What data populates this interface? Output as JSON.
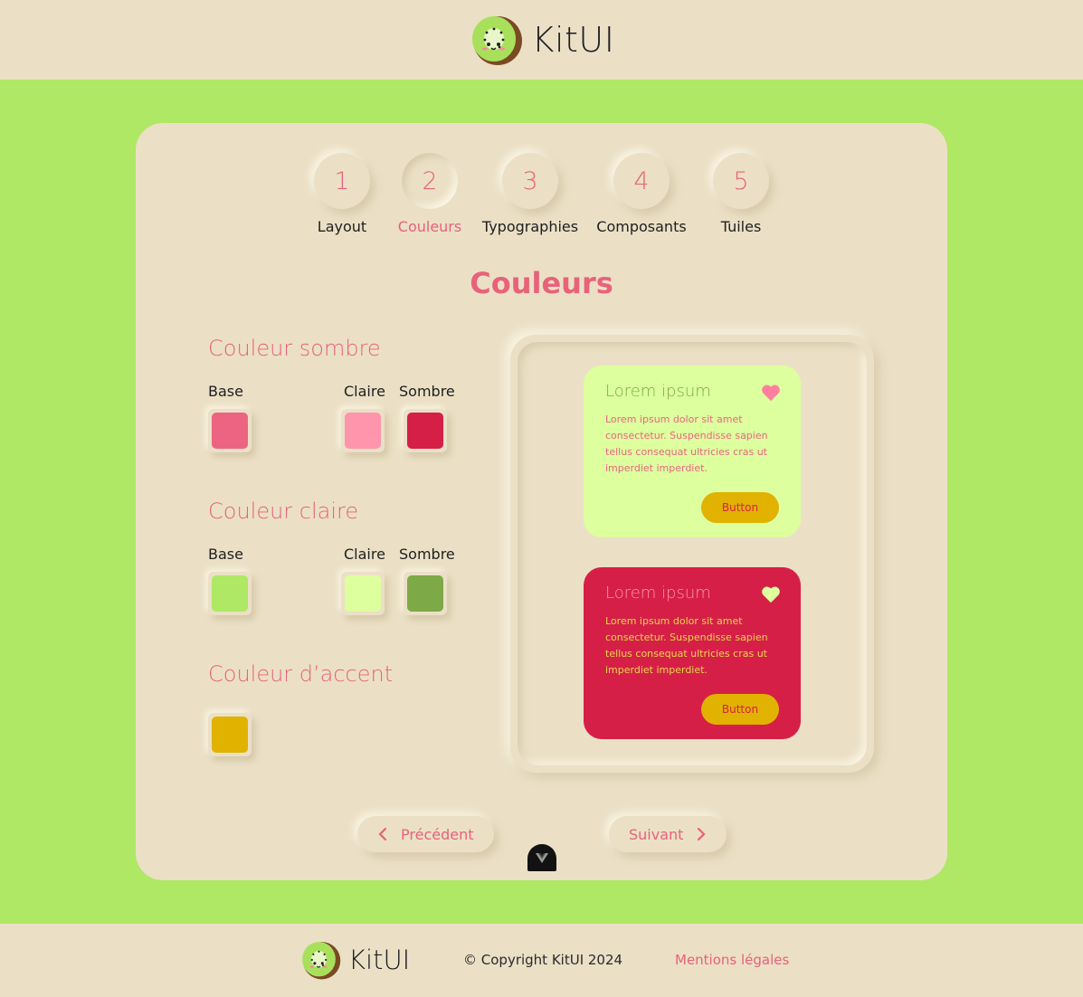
{
  "header": {
    "brand": "KitUI"
  },
  "stepper": [
    {
      "number": "1",
      "label": "Layout",
      "active": false
    },
    {
      "number": "2",
      "label": "Couleurs",
      "active": true
    },
    {
      "number": "3",
      "label": "Typographies",
      "active": false
    },
    {
      "number": "4",
      "label": "Composants",
      "active": false
    },
    {
      "number": "5",
      "label": "Tuiles",
      "active": false
    }
  ],
  "main": {
    "title": "Couleurs",
    "groups": {
      "dark": {
        "title": "Couleur sombre",
        "base_label": "Base",
        "light_label": "Claire",
        "dark_label": "Sombre",
        "base": "#ec6482",
        "light": "#ff95ac",
        "dark": "#d61f47"
      },
      "light": {
        "title": "Couleur claire",
        "base_label": "Base",
        "light_label": "Claire",
        "dark_label": "Sombre",
        "base": "#aee864",
        "light": "#ddff9e",
        "dark": "#7da947"
      },
      "accent": {
        "title": "Couleur d’accent",
        "base": "#e1b200"
      }
    },
    "preview": {
      "light_card": {
        "title": "Lorem ipsum",
        "text": "Lorem ipsum dolor sit amet consectetur. Suspendisse sapien tellus consequat ultricies cras ut imperdiet imperdiet.",
        "button": "Button",
        "bg": "#ddff9e"
      },
      "dark_card": {
        "title": "Lorem ipsum",
        "text": "Lorem ipsum dolor sit amet consectetur. Suspendisse sapien tellus consequat ultricies cras ut imperdiet imperdiet.",
        "button": "Button",
        "bg": "#d61f47"
      }
    },
    "nav": {
      "prev": "Précédent",
      "next": "Suivant"
    }
  },
  "footer": {
    "brand": "KitUI",
    "copyright": "© Copyright KitUI 2024",
    "legal": "Mentions légales"
  },
  "icons": [
    "kiwi-logo-icon",
    "heart-icon",
    "chevron-left-icon",
    "chevron-right-icon",
    "vue-devtools-icon"
  ]
}
